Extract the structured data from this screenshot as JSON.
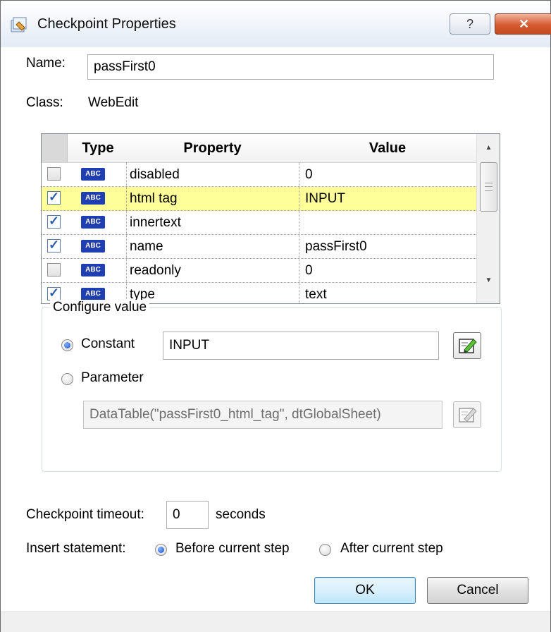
{
  "window": {
    "title": "Checkpoint Properties",
    "help_label": "?",
    "close_label": "✕"
  },
  "name_label": "Name:",
  "name_value": "passFirst0",
  "class_label": "Class:",
  "class_value": "WebEdit",
  "grid": {
    "headers": {
      "type": "Type",
      "property": "Property",
      "value": "Value"
    },
    "type_badge": "ABC",
    "rows": [
      {
        "checked": false,
        "property": "disabled",
        "value": "0"
      },
      {
        "checked": true,
        "property": "html tag",
        "value": "INPUT",
        "selected": true
      },
      {
        "checked": true,
        "property": "innertext",
        "value": ""
      },
      {
        "checked": true,
        "property": "name",
        "value": "passFirst0"
      },
      {
        "checked": false,
        "property": "readonly",
        "value": "0"
      },
      {
        "checked": true,
        "property": "type",
        "value": "text"
      }
    ]
  },
  "configure": {
    "group_title": "Configure value",
    "constant_label": "Constant",
    "constant_value": "INPUT",
    "parameter_label": "Parameter",
    "parameter_value": "DataTable(\"passFirst0_html_tag\", dtGlobalSheet)",
    "selected": "constant"
  },
  "timeout": {
    "label": "Checkpoint timeout:",
    "value": "0",
    "unit": "seconds"
  },
  "insert": {
    "label": "Insert statement:",
    "before_label": "Before current step",
    "after_label": "After current step",
    "selected": "before"
  },
  "buttons": {
    "ok": "OK",
    "cancel": "Cancel"
  },
  "colors": {
    "selected_row": "#ffff99",
    "abc_badge": "#1f3fb0",
    "close_button": "#d45a30"
  }
}
